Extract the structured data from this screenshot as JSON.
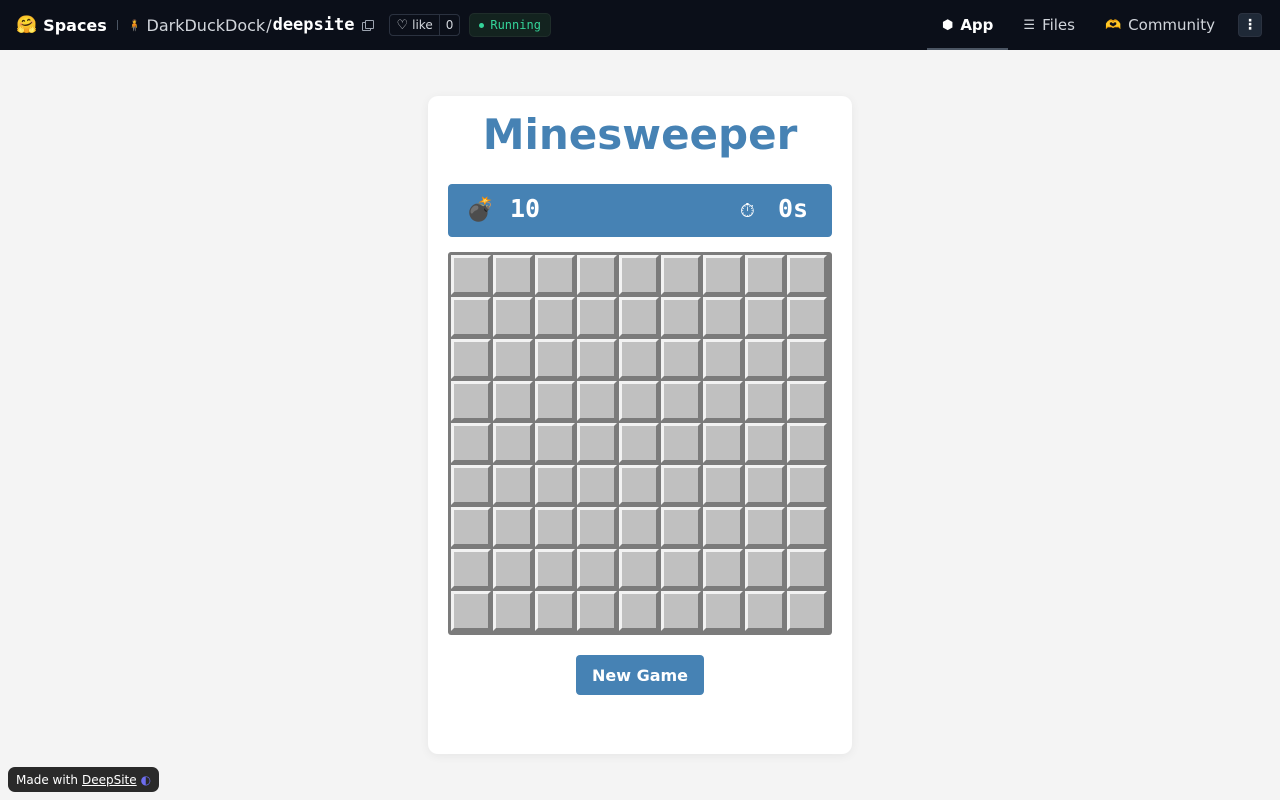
{
  "header": {
    "spaces_label": "Spaces",
    "owner": "DarkDuckDock",
    "repo": "deepsite",
    "like_label": "like",
    "like_count": "0",
    "status": "Running",
    "tabs": [
      {
        "label": "App",
        "icon": "cube-icon"
      },
      {
        "label": "Files",
        "icon": "files-icon"
      },
      {
        "label": "Community",
        "icon": "community-icon"
      }
    ],
    "colors": {
      "bg": "#0b0f19",
      "status": "#34d399"
    }
  },
  "game": {
    "title": "Minesweeper",
    "mines": "10",
    "time": "0s",
    "rows": 9,
    "cols": 9,
    "new_game_label": "New Game",
    "accent": "#4682b4",
    "cell_color": "#c0c0c0"
  },
  "footer": {
    "made_with": "Made with",
    "link": "DeepSite"
  }
}
